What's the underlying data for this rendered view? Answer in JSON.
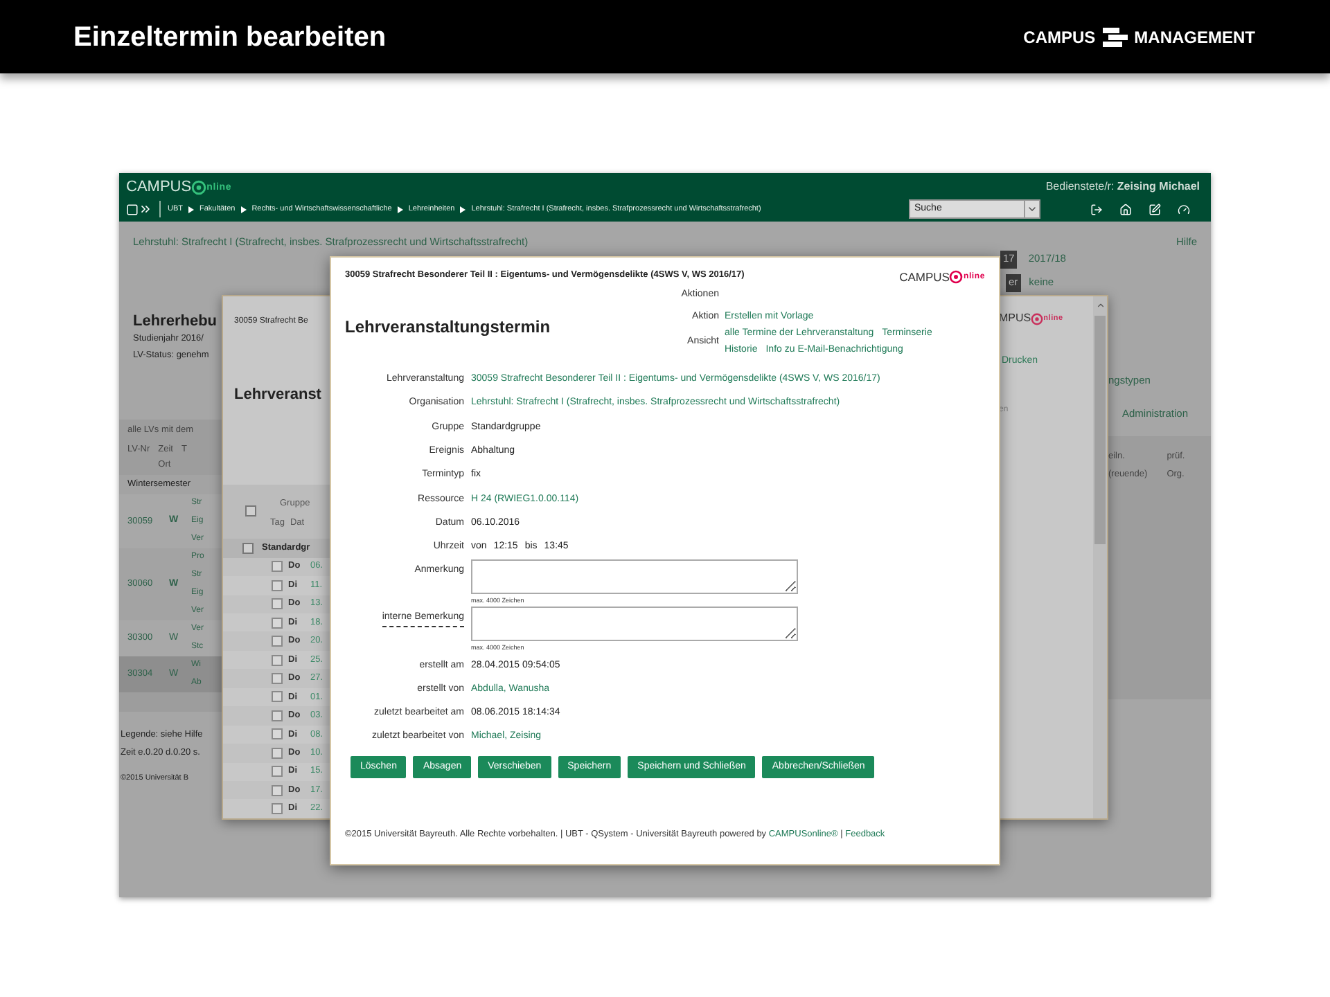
{
  "slide": {
    "title": "Einzeltermin bearbeiten",
    "logo": {
      "left": "CAMPUS",
      "right": "MANAGEMENT"
    }
  },
  "app_header": {
    "logo": {
      "left": "CAMPUS",
      "right": "nline"
    },
    "user": "Bedienstete/r: **Zeising Michael**",
    "breadcrumb": [
      "UBT",
      "Fakultäten",
      "Rechts- und Wirtschaftswissenschaftliche",
      "Lehreinheiten",
      "Lehrstuhl: Strafrecht I (Strafrecht, insbes. Strafprozessrecht und Wirtschaftsstrafrecht)"
    ],
    "search": {
      "value": "Suche"
    }
  },
  "background_page": {
    "org_link": "Lehrstuhl: Strafrecht I (Strafrecht, insbes. Strafprozessrecht und Wirtschaftsstrafrecht)",
    "help": "Hilfe",
    "years": [
      {
        "label": "17",
        "selected": true
      },
      {
        "label": "2017/18",
        "selected": false
      }
    ],
    "filter": {
      "label": "er",
      "value": "keine"
    },
    "title": "Lehrerhebu",
    "lines": [
      "Studienjahr 2016/",
      "LV-Status: genehm"
    ],
    "table": {
      "caption": "alle LVs mit dem",
      "columns": [
        {
          "lines": [
            "LV-Nr"
          ]
        },
        {
          "lines": [
            "Zeit",
            "Ort"
          ]
        },
        {
          "lines": [
            "T"
          ]
        }
      ],
      "right_columns": [
        {
          "lines": [
            "eiln.",
            "(reuende)"
          ]
        },
        {
          "lines": [
            "prüf.",
            "Org."
          ]
        }
      ],
      "semester": "Wintersemester",
      "rows": [
        {
          "nr": "30059",
          "zeit": "W",
          "bold": true,
          "highlighted": false,
          "titles": [
            "Str",
            "Eig",
            "Ver"
          ]
        },
        {
          "nr": "30060",
          "zeit": "W",
          "bold": true,
          "highlighted": false,
          "titles": [
            "Pro",
            "Str",
            "Eig",
            "Ver"
          ]
        },
        {
          "nr": "30300",
          "zeit": "W",
          "bold": false,
          "highlighted": false,
          "titles": [
            "Ver",
            "Stc"
          ]
        },
        {
          "nr": "30304",
          "zeit": "W",
          "bold": false,
          "highlighted": true,
          "titles": [
            "Wi",
            "Ab"
          ]
        }
      ]
    },
    "right_links": [
      "ngstypen",
      "Administration"
    ],
    "legend": "Legende: siehe Hilfe",
    "timing": "Zeit e.0.20 d.0.20 s.",
    "copyright": "©2015 Universität B"
  },
  "middle_window": {
    "header": "30059 Strafrecht Be",
    "title": "Lehrveranst",
    "logo": {
      "left": "MPUS",
      "right": "nline"
    },
    "print": "Drucken",
    "fragment": "en",
    "table": {
      "group_header": "Gruppe",
      "day_header": "Tag",
      "date_header": "Dat",
      "group": "Standardgr",
      "header_checked": false,
      "group_checked": false,
      "rows": [
        {
          "day": "Do",
          "date": "06.",
          "checked": false
        },
        {
          "day": "Di",
          "date": "11.",
          "checked": false
        },
        {
          "day": "Do",
          "date": "13.",
          "checked": false
        },
        {
          "day": "Di",
          "date": "18.",
          "checked": false
        },
        {
          "day": "Do",
          "date": "20.",
          "checked": false
        },
        {
          "day": "Di",
          "date": "25.",
          "checked": false
        },
        {
          "day": "Do",
          "date": "27.",
          "checked": false
        },
        {
          "day": "Di",
          "date": "01.",
          "checked": false
        },
        {
          "day": "Do",
          "date": "03.",
          "checked": false
        },
        {
          "day": "Di",
          "date": "08.",
          "checked": false
        },
        {
          "day": "Do",
          "date": "10.",
          "checked": false
        },
        {
          "day": "Di",
          "date": "15.",
          "checked": false
        },
        {
          "day": "Do",
          "date": "17.",
          "checked": false
        },
        {
          "day": "Di",
          "date": "22.",
          "checked": false
        }
      ]
    }
  },
  "dialog": {
    "header": "30059 Strafrecht Besonderer Teil II : Eigentums- und Vermögensdelikte (4SWS V, WS 2016/17)",
    "logo": {
      "left": "CAMPUS",
      "right": "nline"
    },
    "actions_title": "Aktionen",
    "title": "Lehrveranstaltungstermin",
    "actions": [
      {
        "label": "Aktion",
        "lines": [
          [
            "Erstellen mit Vorlage"
          ]
        ]
      },
      {
        "label": "Ansicht",
        "lines": [
          [
            "alle Termine der Lehrveranstaltung",
            "Terminserie"
          ],
          [
            "Historie",
            "Info zu E-Mail-Benachrichtigung"
          ]
        ]
      }
    ],
    "fields": [
      {
        "label": "Lehrveranstaltung",
        "kind": "link",
        "dashed_label": false,
        "value": "30059 Strafrecht Besonderer Teil II : Eigentums- und Vermögensdelikte (4SWS V, WS 2016/17)"
      },
      {
        "label": "Organisation",
        "kind": "link",
        "dashed_label": false,
        "value": "Lehrstuhl: Strafrecht I (Strafrecht, insbes. Strafprozessrecht und Wirtschaftsstrafrecht)"
      },
      {
        "label": "Gruppe",
        "kind": "text",
        "dashed_label": false,
        "value": "Standardgruppe"
      },
      {
        "label": "Ereignis",
        "kind": "text",
        "dashed_label": false,
        "value": "Abhaltung"
      },
      {
        "label": "Termintyp",
        "kind": "text",
        "dashed_label": false,
        "value": "fix"
      },
      {
        "label": "Ressource",
        "kind": "link",
        "dashed_label": false,
        "value": "H 24 (RWIEG1.0.00.114)"
      },
      {
        "label": "Datum",
        "kind": "text",
        "dashed_label": false,
        "value": "06.10.2016"
      },
      {
        "label": "Uhrzeit",
        "kind": "time",
        "dashed_label": false,
        "parts": [
          "von",
          "12:15",
          "bis",
          "13:45"
        ]
      },
      {
        "label": "Anmerkung",
        "kind": "textarea",
        "dashed_label": false,
        "hint": "max. 4000 Zeichen"
      },
      {
        "label": "interne Bemerkung",
        "kind": "textarea",
        "dashed_label": true,
        "hint": "max. 4000 Zeichen"
      },
      {
        "label": "erstellt am",
        "kind": "text",
        "dashed_label": false,
        "value": "28.04.2015 09:54:05"
      },
      {
        "label": "erstellt von",
        "kind": "link",
        "dashed_label": false,
        "value": "Abdulla, Wanusha"
      },
      {
        "label": "zuletzt bearbeitet am",
        "kind": "text",
        "dashed_label": false,
        "value": "08.06.2015 18:14:34"
      },
      {
        "label": "zuletzt bearbeitet von",
        "kind": "link",
        "dashed_label": false,
        "value": "Michael, Zeising"
      }
    ],
    "buttons": [
      "Löschen",
      "Absagen",
      "Verschieben",
      "Speichern",
      "Speichern und Schließen",
      "Abbrechen/Schließen"
    ],
    "footer": [
      {
        "kind": "text",
        "text": "©2015 Universität Bayreuth. Alle Rechte vorbehalten. | UBT - QSystem - Universität Bayreuth powered by "
      },
      {
        "kind": "link",
        "text": "CAMPUSonline®"
      },
      {
        "kind": "text",
        "text": " | "
      },
      {
        "kind": "link",
        "text": "Feedback"
      }
    ]
  }
}
